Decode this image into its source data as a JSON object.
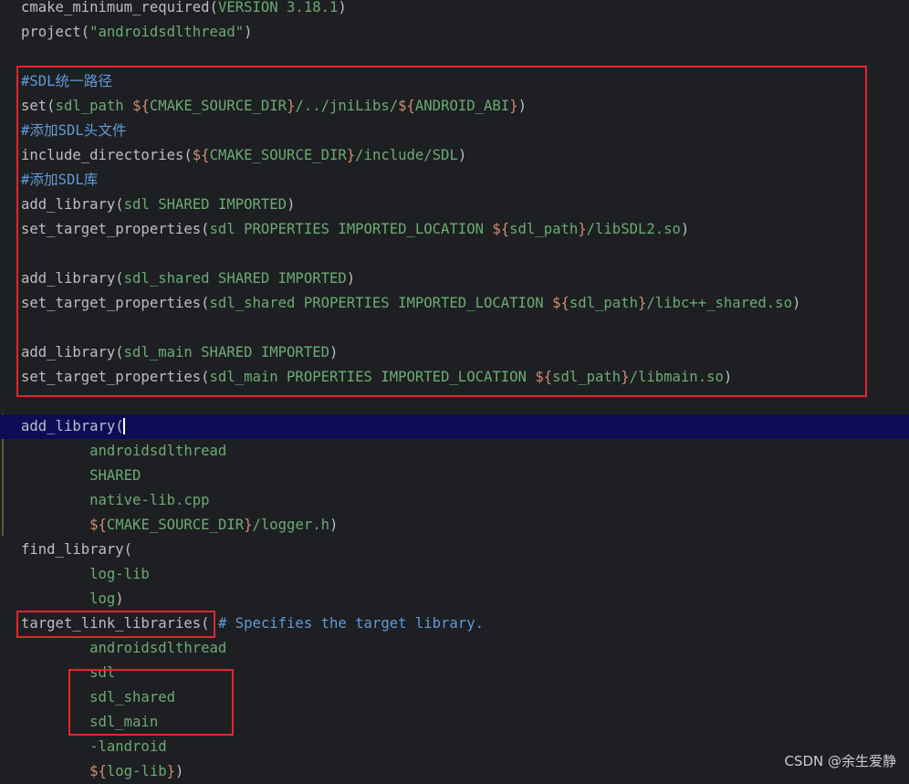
{
  "colors": {
    "background": "#1e1f22",
    "function": "#bcbec4",
    "argument": "#6aab73",
    "variable": "#cf8e6d",
    "comment": "#5f9bd8",
    "highlight_line": "#0d0d56",
    "annotation_box": "#e1262d"
  },
  "lines": [
    [
      {
        "t": "cmake_minimum_required",
        "c": "fn"
      },
      {
        "t": "(",
        "c": "paren"
      },
      {
        "t": "VERSION 3.18.1",
        "c": "arg"
      },
      {
        "t": ")",
        "c": "paren"
      }
    ],
    [
      {
        "t": "project",
        "c": "fn"
      },
      {
        "t": "(",
        "c": "paren"
      },
      {
        "t": "\"androidsdlthread\"",
        "c": "str"
      },
      {
        "t": ")",
        "c": "paren"
      }
    ],
    [],
    [
      {
        "t": "#SDL统一路径",
        "c": "comment"
      }
    ],
    [
      {
        "t": "set",
        "c": "fn"
      },
      {
        "t": "(",
        "c": "paren"
      },
      {
        "t": "sdl_path ",
        "c": "arg"
      },
      {
        "t": "${",
        "c": "var"
      },
      {
        "t": "CMAKE_SOURCE_DIR",
        "c": "arg"
      },
      {
        "t": "}",
        "c": "var"
      },
      {
        "t": "/../jniLibs/",
        "c": "arg"
      },
      {
        "t": "${",
        "c": "var"
      },
      {
        "t": "ANDROID_ABI",
        "c": "arg"
      },
      {
        "t": "}",
        "c": "var"
      },
      {
        "t": ")",
        "c": "paren"
      }
    ],
    [
      {
        "t": "#添加SDL头文件",
        "c": "comment"
      }
    ],
    [
      {
        "t": "include_directories",
        "c": "fn"
      },
      {
        "t": "(",
        "c": "paren"
      },
      {
        "t": "${",
        "c": "var"
      },
      {
        "t": "CMAKE_SOURCE_DIR",
        "c": "arg"
      },
      {
        "t": "}",
        "c": "var"
      },
      {
        "t": "/include/SDL",
        "c": "arg"
      },
      {
        "t": ")",
        "c": "paren"
      }
    ],
    [
      {
        "t": "#添加SDL库",
        "c": "comment"
      }
    ],
    [
      {
        "t": "add_library",
        "c": "fn"
      },
      {
        "t": "(",
        "c": "paren"
      },
      {
        "t": "sdl SHARED IMPORTED",
        "c": "arg"
      },
      {
        "t": ")",
        "c": "paren"
      }
    ],
    [
      {
        "t": "set_target_properties",
        "c": "fn"
      },
      {
        "t": "(",
        "c": "paren"
      },
      {
        "t": "sdl PROPERTIES IMPORTED_LOCATION ",
        "c": "arg"
      },
      {
        "t": "${",
        "c": "var"
      },
      {
        "t": "sdl_path",
        "c": "arg"
      },
      {
        "t": "}",
        "c": "var"
      },
      {
        "t": "/libSDL2.so",
        "c": "arg"
      },
      {
        "t": ")",
        "c": "paren"
      }
    ],
    [],
    [
      {
        "t": "add_library",
        "c": "fn"
      },
      {
        "t": "(",
        "c": "paren"
      },
      {
        "t": "sdl_shared SHARED IMPORTED",
        "c": "arg"
      },
      {
        "t": ")",
        "c": "paren"
      }
    ],
    [
      {
        "t": "set_target_properties",
        "c": "fn"
      },
      {
        "t": "(",
        "c": "paren"
      },
      {
        "t": "sdl_shared PROPERTIES IMPORTED_LOCATION ",
        "c": "arg"
      },
      {
        "t": "${",
        "c": "var"
      },
      {
        "t": "sdl_path",
        "c": "arg"
      },
      {
        "t": "}",
        "c": "var"
      },
      {
        "t": "/libc++_shared.so",
        "c": "arg"
      },
      {
        "t": ")",
        "c": "paren"
      }
    ],
    [],
    [
      {
        "t": "add_library",
        "c": "fn"
      },
      {
        "t": "(",
        "c": "paren"
      },
      {
        "t": "sdl_main SHARED IMPORTED",
        "c": "arg"
      },
      {
        "t": ")",
        "c": "paren"
      }
    ],
    [
      {
        "t": "set_target_properties",
        "c": "fn"
      },
      {
        "t": "(",
        "c": "paren"
      },
      {
        "t": "sdl_main PROPERTIES IMPORTED_LOCATION ",
        "c": "arg"
      },
      {
        "t": "${",
        "c": "var"
      },
      {
        "t": "sdl_path",
        "c": "arg"
      },
      {
        "t": "}",
        "c": "var"
      },
      {
        "t": "/libmain.so",
        "c": "arg"
      },
      {
        "t": ")",
        "c": "paren"
      }
    ],
    [],
    [
      {
        "t": "add_library",
        "c": "fn"
      },
      {
        "t": "(",
        "c": "paren"
      },
      {
        "t": "",
        "c": "caret"
      }
    ],
    [
      {
        "t": "        androidsdlthread",
        "c": "arg"
      }
    ],
    [
      {
        "t": "        SHARED",
        "c": "arg"
      }
    ],
    [
      {
        "t": "        native-lib.cpp",
        "c": "arg"
      }
    ],
    [
      {
        "t": "        ",
        "c": "arg"
      },
      {
        "t": "${",
        "c": "var"
      },
      {
        "t": "CMAKE_SOURCE_DIR",
        "c": "arg"
      },
      {
        "t": "}",
        "c": "var"
      },
      {
        "t": "/logger.h",
        "c": "arg"
      },
      {
        "t": ")",
        "c": "paren"
      }
    ],
    [
      {
        "t": "find_library",
        "c": "fn"
      },
      {
        "t": "(",
        "c": "paren"
      }
    ],
    [
      {
        "t": "        log-lib",
        "c": "arg"
      }
    ],
    [
      {
        "t": "        log",
        "c": "arg"
      },
      {
        "t": ")",
        "c": "paren"
      }
    ],
    [
      {
        "t": "target_link_libraries",
        "c": "fn"
      },
      {
        "t": "( ",
        "c": "paren"
      },
      {
        "t": "# Specifies the target library.",
        "c": "comment"
      }
    ],
    [
      {
        "t": "        androidsdlthread",
        "c": "arg"
      }
    ],
    [
      {
        "t": "        sdl",
        "c": "arg"
      }
    ],
    [
      {
        "t": "        sdl_shared",
        "c": "arg"
      }
    ],
    [
      {
        "t": "        sdl_main",
        "c": "arg"
      }
    ],
    [
      {
        "t": "        -landroid",
        "c": "arg"
      }
    ],
    [
      {
        "t": "        ",
        "c": "arg"
      },
      {
        "t": "${",
        "c": "var"
      },
      {
        "t": "log-lib",
        "c": "arg"
      },
      {
        "t": "}",
        "c": "var"
      },
      {
        "t": ")",
        "c": "paren"
      }
    ]
  ],
  "watermark": "CSDN @余生爱静"
}
